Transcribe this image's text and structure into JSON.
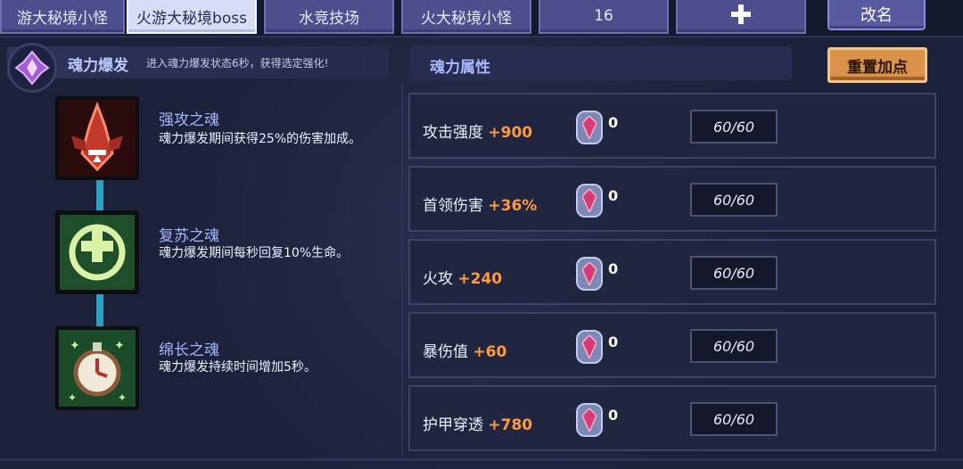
{
  "tabs": [
    {
      "label": "游大秘境小怪"
    },
    {
      "label": "火游大秘境boss",
      "active": true
    },
    {
      "label": "水竞技场"
    },
    {
      "label": "火大秘境小怪"
    },
    {
      "label": "16"
    },
    {
      "label": "",
      "icon": "plus-icon"
    }
  ],
  "rename_button": "改名",
  "burst": {
    "title": "魂力爆发",
    "description": "进入魂力爆发状态6秒，获得选定强化!",
    "icon": "purple-crystal-icon"
  },
  "souls": [
    {
      "name": "强攻之魂",
      "description": "魂力爆发期间获得25%的伤害加成。",
      "icon": "red-sword-icon",
      "color": "#c0392b"
    },
    {
      "name": "复苏之魂",
      "description": "魂力爆发期间每秒回复10%生命。",
      "icon": "green-heal-icon",
      "color": "#8fd16a"
    },
    {
      "name": "绵长之魂",
      "description": "魂力爆发持续时间增加5秒。",
      "icon": "stopwatch-icon",
      "color": "#7ed98a"
    }
  ],
  "attributes": {
    "title": "魂力属性",
    "reset_button": "重置加点",
    "rows": [
      {
        "label": "攻击强度",
        "bonus": "+900",
        "count": "0",
        "cap": "60/60"
      },
      {
        "label": "首领伤害",
        "bonus": "+36%",
        "count": "0",
        "cap": "60/60"
      },
      {
        "label": "火攻",
        "bonus": "+240",
        "count": "0",
        "cap": "60/60"
      },
      {
        "label": "暴伤值",
        "bonus": "+60",
        "count": "0",
        "cap": "60/60"
      },
      {
        "label": "护甲穿透",
        "bonus": "+780",
        "count": "0",
        "cap": "60/60"
      }
    ]
  },
  "colors": {
    "accent_orange": "#ff9a3c",
    "tab_active": "#d8dcf5",
    "reset_button": "#d9924a"
  }
}
